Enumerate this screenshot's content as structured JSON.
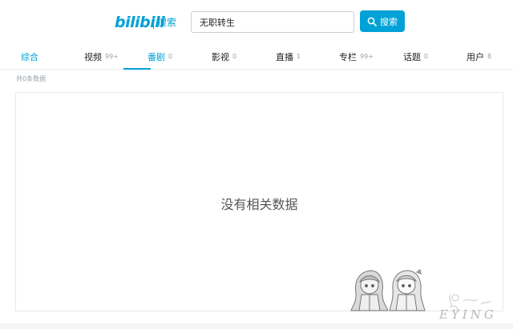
{
  "header": {
    "logo_text": "bilibili",
    "logo_sub": "搜索",
    "search_value": "无职转生",
    "search_button": "搜索"
  },
  "tabs": [
    {
      "label": "综合",
      "count": "",
      "selected": false
    },
    {
      "label": "视频",
      "count": "99+",
      "selected": false
    },
    {
      "label": "番剧",
      "count": "0",
      "selected": true
    },
    {
      "label": "影视",
      "count": "0",
      "selected": false
    },
    {
      "label": "直播",
      "count": "1",
      "selected": false
    },
    {
      "label": "专栏",
      "count": "99+",
      "selected": false
    },
    {
      "label": "话题",
      "count": "0",
      "selected": false
    },
    {
      "label": "用户",
      "count": "8",
      "selected": false
    }
  ],
  "result_count": "共0条数据",
  "empty_message": "没有相关数据",
  "watermark_text": "EYING",
  "colors": {
    "accent": "#00a1d6",
    "border": "#e5e9ef",
    "muted": "#99a2aa"
  }
}
